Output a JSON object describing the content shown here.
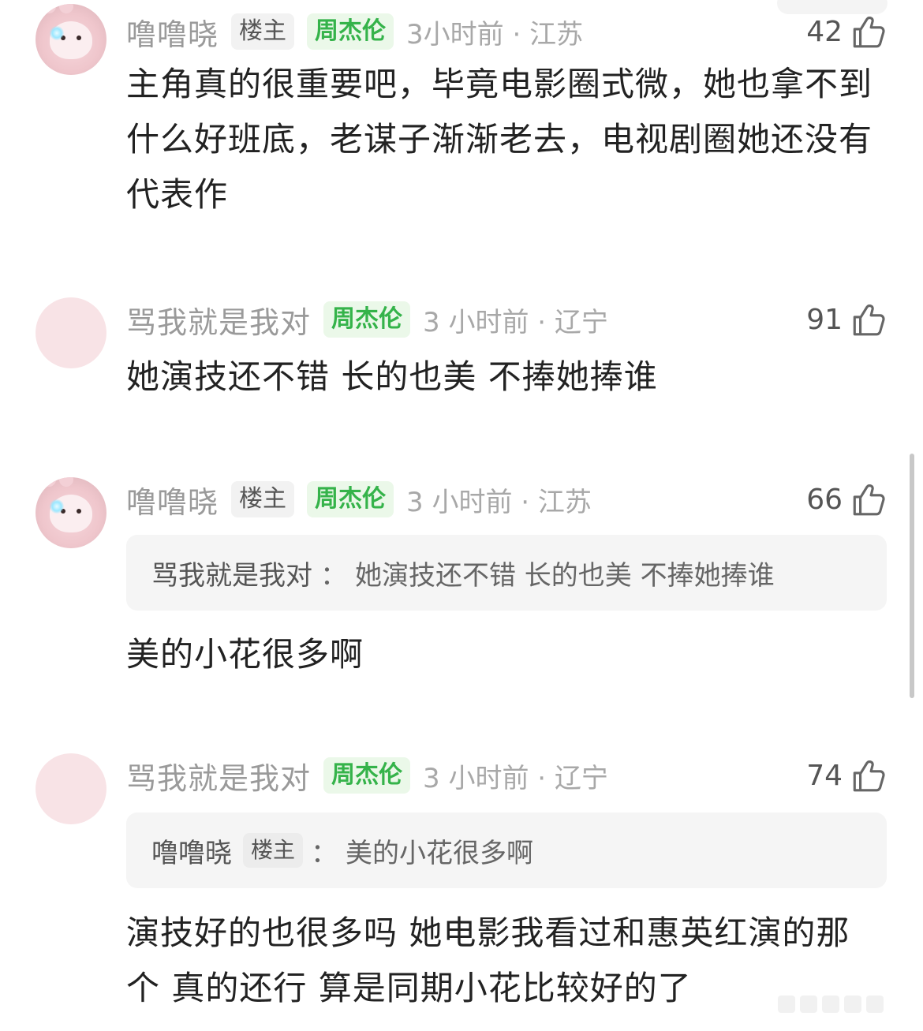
{
  "comments": [
    {
      "username": "噜噜晓",
      "tags": [
        "楼主",
        "周杰伦"
      ],
      "meta": "3小时前 · 江苏",
      "likes": "42",
      "text": "主角真的很重要吧，毕竟电影圈式微，她也拿不到什么好班底，老谋子渐渐老去，电视剧圈她还没有代表作"
    },
    {
      "username": "骂我就是我对",
      "fan_tag": "周杰伦",
      "meta": "3 小时前 · 辽宁",
      "likes": "91",
      "text": "她演技还不错 长的也美 不捧她捧谁"
    },
    {
      "username": "噜噜晓",
      "owner_tag": "楼主",
      "fan_tag": "周杰伦",
      "meta": "3 小时前 · 江苏",
      "likes": "66",
      "quote": {
        "author": "骂我就是我对",
        "colon": "：",
        "text": "她演技还不错 长的也美 不捧她捧谁"
      },
      "text": "美的小花很多啊"
    },
    {
      "username": "骂我就是我对",
      "fan_tag": "周杰伦",
      "meta": "3 小时前 · 辽宁",
      "likes": "74",
      "quote": {
        "author": "噜噜晓",
        "owner_tag": "楼主",
        "colon": "：",
        "text": "美的小花很多啊"
      },
      "text": "演技好的也很多吗 她电影我看过和惠英红演的那个 真的还行 算是同期小花比较好的了"
    }
  ],
  "icons": {
    "like": "thumbs-up-icon"
  },
  "colors": {
    "fan_tag_text": "#35b34a",
    "fan_tag_bg": "#ebf8e9",
    "meta": "#a8a8a8",
    "avatar_blank": "#f8e3e6"
  }
}
